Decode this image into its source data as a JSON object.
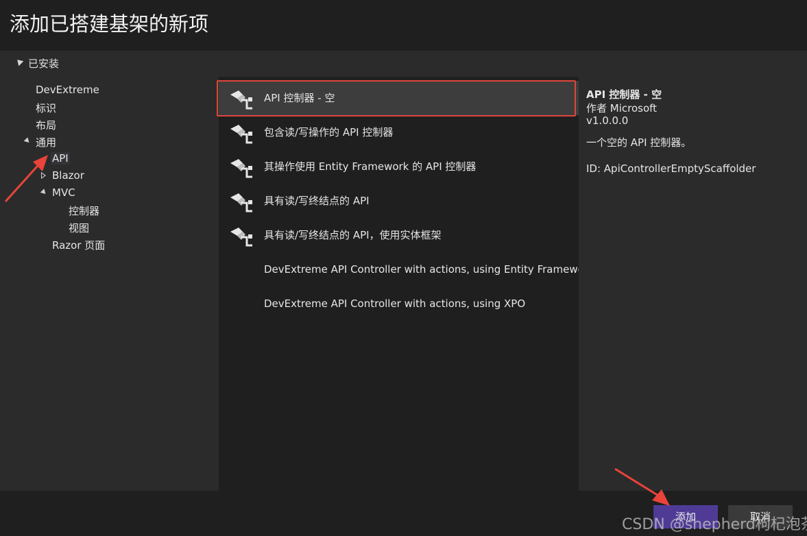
{
  "window": {
    "title": "添加已搭建基架的新项"
  },
  "tree": {
    "root_label": "已安装",
    "items": [
      {
        "label": "DevExtreme"
      },
      {
        "label": "标识"
      },
      {
        "label": "布局"
      },
      {
        "label": "通用"
      },
      {
        "label": "API"
      },
      {
        "label": "Blazor"
      },
      {
        "label": "MVC"
      },
      {
        "label": "控制器"
      },
      {
        "label": "视图"
      },
      {
        "label": "Razor 页面"
      }
    ]
  },
  "templates": [
    {
      "label": "API 控制器 - 空",
      "icon": "scaffold-icon",
      "selected": true
    },
    {
      "label": "包含读/写操作的 API 控制器",
      "icon": "scaffold-icon"
    },
    {
      "label": "其操作使用 Entity Framework 的 API 控制器",
      "icon": "scaffold-icon"
    },
    {
      "label": "具有读/写终结点的 API",
      "icon": "scaffold-icon"
    },
    {
      "label": "具有读/写终结点的 API，使用实体框架",
      "icon": "scaffold-icon"
    },
    {
      "label": "DevExtreme API Controller with actions, using Entity Framework"
    },
    {
      "label": "DevExtreme API Controller with actions, using XPO"
    }
  ],
  "details": {
    "name": "API 控制器 - 空",
    "author": "作者 Microsoft",
    "version": "v1.0.0.0",
    "description": "一个空的 API 控制器。",
    "id": "ID: ApiControllerEmptyScaffolder"
  },
  "buttons": {
    "add": "添加",
    "cancel": "取消"
  },
  "watermark": "CSDN @shepherd枸杞泡茶",
  "colors": {
    "accent": "#4f3b96",
    "highlight_border": "#e0453a",
    "annotation_arrow": "#e8443a"
  }
}
